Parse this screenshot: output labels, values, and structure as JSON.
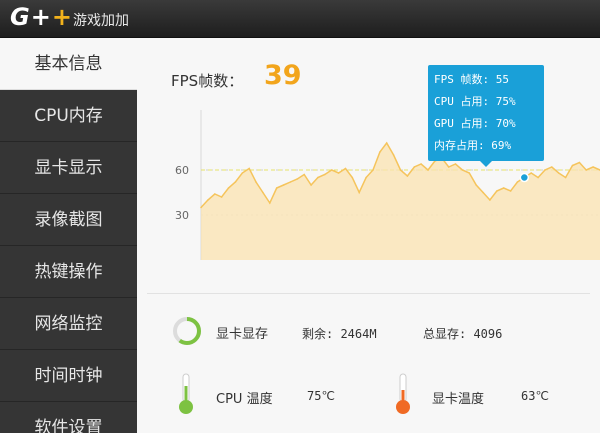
{
  "app": {
    "logo": "G++",
    "title": "游戏加加"
  },
  "sidebar": {
    "items": [
      {
        "label": "基本信息",
        "active": true
      },
      {
        "label": "CPU内存",
        "active": false
      },
      {
        "label": "显卡显示",
        "active": false
      },
      {
        "label": "录像截图",
        "active": false
      },
      {
        "label": "热键操作",
        "active": false
      },
      {
        "label": "网络监控",
        "active": false
      },
      {
        "label": "时间时钟",
        "active": false
      },
      {
        "label": "软件设置",
        "active": false
      }
    ]
  },
  "fps": {
    "label": "FPS帧数：",
    "value": "39"
  },
  "tooltip": {
    "lines": [
      "FPS 帧数: 55",
      "CPU 占用: 75%",
      "GPU 占用: 70%",
      "内存占用: 69%"
    ]
  },
  "vram": {
    "label": "显卡显存",
    "remaining": "剩余: 2464M",
    "total": "总显存: 4096",
    "used_fraction": 0.4
  },
  "temps": {
    "cpu": {
      "label": "CPU 温度",
      "value": "75℃",
      "color": "#7dc242"
    },
    "gpu": {
      "label": "显卡温度",
      "value": "63℃",
      "color": "#f06a24"
    }
  },
  "colors": {
    "accent": "#f2a51c",
    "tooltip": "#1aa0d8",
    "fill": "#fbe3b0",
    "line": "#f5c45c",
    "ring": "#7dc242"
  },
  "chart_data": {
    "type": "area",
    "ylim": [
      0,
      100
    ],
    "yticks": [
      30,
      60
    ],
    "grid": "dotted horizontal lines",
    "values": [
      35,
      40,
      44,
      42,
      48,
      52,
      58,
      61,
      52,
      45,
      38,
      48,
      50,
      52,
      54,
      57,
      50,
      55,
      57,
      60,
      58,
      61,
      55,
      45,
      55,
      60,
      72,
      78,
      70,
      60,
      56,
      62,
      64,
      60,
      66,
      68,
      62,
      64,
      60,
      58,
      50,
      45,
      40,
      46,
      48,
      46,
      52,
      55,
      58,
      55,
      60,
      62,
      58,
      55,
      63,
      65,
      60,
      62,
      60
    ],
    "highlight_value": 55,
    "reference_line": 60
  }
}
